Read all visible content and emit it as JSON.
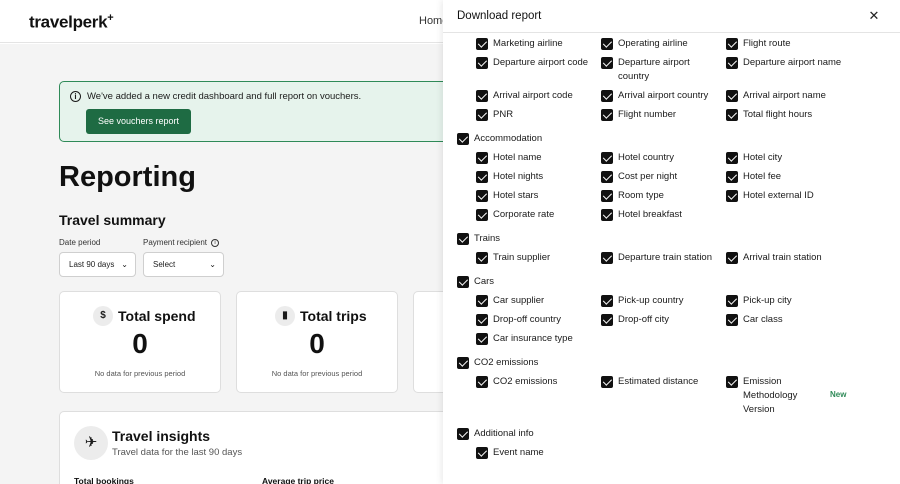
{
  "app": {
    "logo": "travelperk",
    "logo_mark": "+"
  },
  "nav": {
    "home": "Home"
  },
  "banner": {
    "info_icon": "info-icon",
    "text": "We've added a new credit dashboard and full report on vouchers.",
    "button": "See vouchers report"
  },
  "page": {
    "title": "Reporting",
    "section": "Travel summary"
  },
  "filters": {
    "date_period": {
      "label": "Date period",
      "value": "Last 90 days"
    },
    "payment_recipient": {
      "label": "Payment recipient",
      "value": "Select"
    }
  },
  "cards": [
    {
      "icon": "dollar-icon",
      "title": "Total spend",
      "value": "0",
      "note": "No data for previous period"
    },
    {
      "icon": "luggage-icon",
      "title": "Total trips",
      "value": "0",
      "note": "No data for previous period"
    }
  ],
  "insights": {
    "icon": "plane-icon",
    "title": "Travel insights",
    "subtitle": "Travel data for the last 90 days",
    "col1": "Total bookings",
    "col2": "Average trip price"
  },
  "drawer": {
    "title": "Download report",
    "flights": [
      "Marketing airline",
      "Operating airline",
      "Flight route",
      "Departure airport code",
      "Departure airport country",
      "Departure airport name",
      "Arrival airport code",
      "Arrival airport country",
      "Arrival airport name",
      "PNR",
      "Flight number",
      "Total flight hours"
    ],
    "accommodation": {
      "label": "Accommodation",
      "items": [
        "Hotel name",
        "Hotel country",
        "Hotel city",
        "Hotel nights",
        "Cost per night",
        "Hotel fee",
        "Hotel stars",
        "Room type",
        "Hotel external ID",
        "Corporate rate",
        "Hotel breakfast"
      ]
    },
    "trains": {
      "label": "Trains",
      "items": [
        "Train supplier",
        "Departure train station",
        "Arrival train station"
      ]
    },
    "cars": {
      "label": "Cars",
      "items": [
        "Car supplier",
        "Pick-up country",
        "Pick-up city",
        "Drop-off country",
        "Drop-off city",
        "Car class",
        "Car insurance type"
      ]
    },
    "co2": {
      "label": "CO2 emissions",
      "items": [
        "CO2 emissions",
        "Estimated distance",
        "Emission Methodology Version"
      ],
      "new_badge": "New"
    },
    "additional": {
      "label": "Additional info",
      "items": [
        "Event name"
      ]
    }
  }
}
